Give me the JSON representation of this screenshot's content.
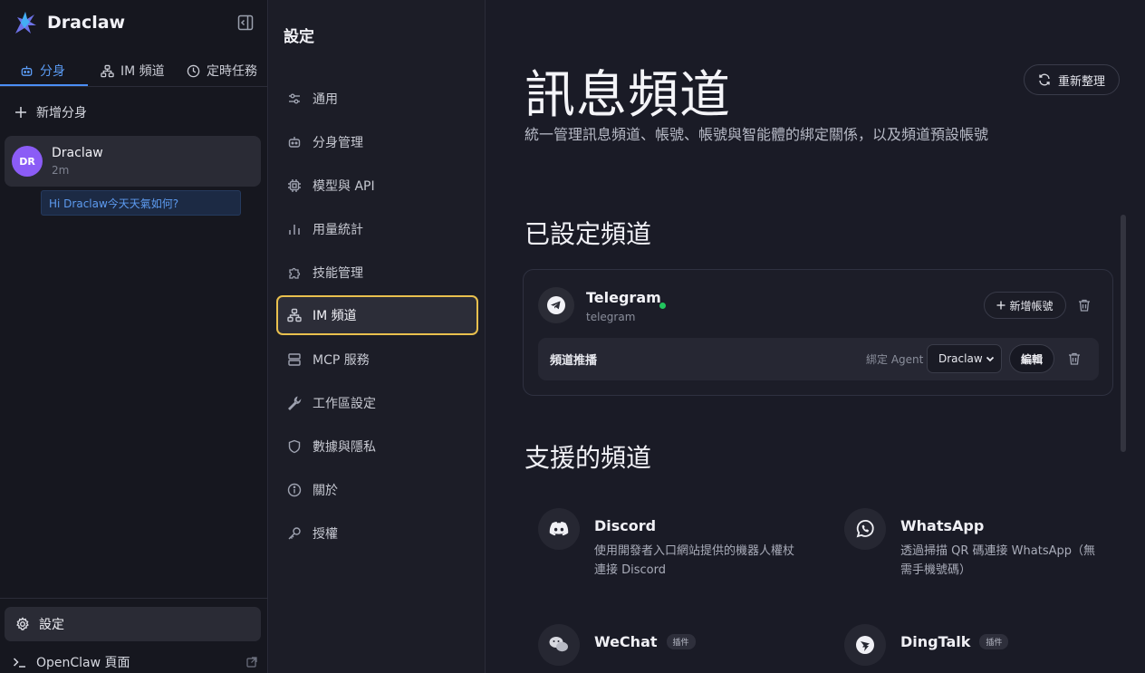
{
  "app": {
    "name": "Draclaw"
  },
  "sidebar": {
    "tabs": [
      {
        "label": "分身",
        "icon": "robot-icon",
        "active": true
      },
      {
        "label": "IM 頻道",
        "icon": "network-icon",
        "active": false
      },
      {
        "label": "定時任務",
        "icon": "clock-icon",
        "active": false
      }
    ],
    "new_agent_label": "新增分身",
    "agents": [
      {
        "initials": "DR",
        "name": "Draclaw",
        "time": "2m",
        "last_message": "Hi Draclaw今天天氣如何?"
      }
    ],
    "settings_label": "設定",
    "openclaw_label": "OpenClaw 頁面"
  },
  "settings_nav": {
    "title": "設定",
    "items": [
      {
        "label": "通用",
        "icon": "sliders-icon"
      },
      {
        "label": "分身管理",
        "icon": "robot-icon"
      },
      {
        "label": "模型與 API",
        "icon": "chip-icon"
      },
      {
        "label": "用量統計",
        "icon": "bar-chart-icon"
      },
      {
        "label": "技能管理",
        "icon": "puzzle-icon"
      },
      {
        "label": "IM 頻道",
        "icon": "network-icon",
        "active": true
      },
      {
        "label": "MCP 服務",
        "icon": "server-icon"
      },
      {
        "label": "工作區設定",
        "icon": "wrench-icon"
      },
      {
        "label": "數據與隱私",
        "icon": "shield-icon"
      },
      {
        "label": "關於",
        "icon": "info-icon"
      },
      {
        "label": "授權",
        "icon": "key-icon"
      }
    ]
  },
  "main": {
    "title": "訊息頻道",
    "subtitle": "統一管理訊息頻道、帳號、帳號與智能體的綁定關係，以及頻道預設帳號",
    "refresh_label": "重新整理",
    "configured_title": "已設定頻道",
    "configured_channels": [
      {
        "name": "Telegram",
        "id": "telegram",
        "status_color": "#22c55e",
        "add_account_label": "新增帳號",
        "bindings": [
          {
            "name": "頻道推播",
            "bind_label": "綁定 Agent",
            "agent": "Draclaw",
            "edit_label": "編輯"
          }
        ]
      }
    ],
    "supported_title": "支援的頻道",
    "supported_channels": [
      {
        "name": "Discord",
        "description": "使用開發者入口網站提供的機器人權杖連接 Discord",
        "icon": "discord-icon",
        "badge": ""
      },
      {
        "name": "WhatsApp",
        "description": "透過掃描 QR 碼連接 WhatsApp（無需手機號碼）",
        "icon": "whatsapp-icon",
        "badge": ""
      },
      {
        "name": "WeChat",
        "description": "",
        "icon": "wechat-icon",
        "badge": "插件"
      },
      {
        "name": "DingTalk",
        "description": "",
        "icon": "dingtalk-icon",
        "badge": "插件"
      }
    ]
  },
  "colors": {
    "accent": "#4b8ef5",
    "active_border": "#e9c04e",
    "avatar": "#8b5cf6"
  }
}
